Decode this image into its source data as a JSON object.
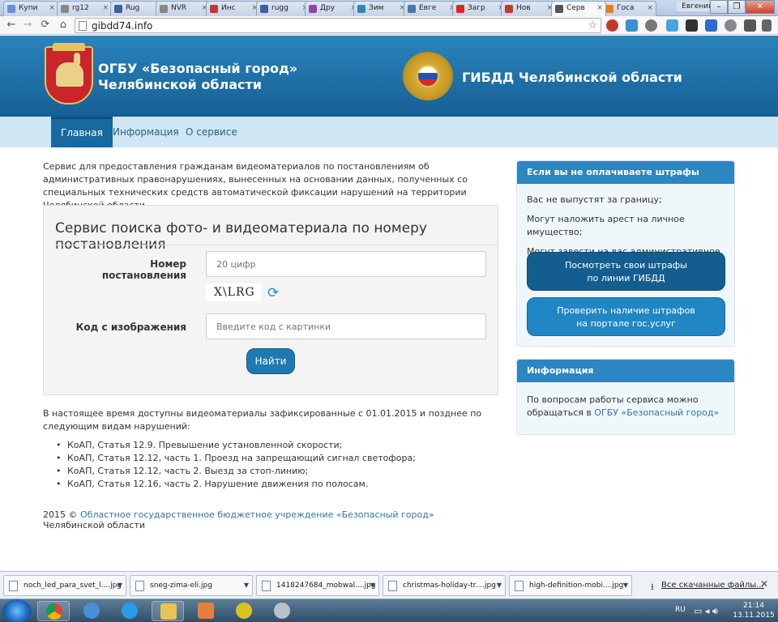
{
  "browser": {
    "tabs": [
      {
        "label": "Купи",
        "color": "#6b8fd6"
      },
      {
        "label": "rg12",
        "color": "#888888"
      },
      {
        "label": "Rug",
        "color": "#3b5fa8"
      },
      {
        "label": "NVR",
        "color": "#888888"
      },
      {
        "label": "Инс",
        "color": "#c0392b"
      },
      {
        "label": "rugg",
        "color": "#3b5fa8"
      },
      {
        "label": "Дру",
        "color": "#8e44ad"
      },
      {
        "label": "Зим",
        "color": "#2e86c1"
      },
      {
        "label": "Евге",
        "color": "#4a76a8"
      },
      {
        "label": "Загр",
        "color": "#e02424"
      },
      {
        "label": "Нов",
        "color": "#c0392b"
      },
      {
        "label": "Серв",
        "color": "#555555"
      },
      {
        "label": "Госа",
        "color": "#e67e22"
      }
    ],
    "user": "Евгений",
    "url": "gibdd74.info"
  },
  "header": {
    "org_title": "ОГБУ «Безопасный город» Челябинской области",
    "gibdd_title": "ГИБДД Челябинской области"
  },
  "nav": {
    "items": [
      "Главная",
      "Информация",
      "О сервисе"
    ]
  },
  "main": {
    "intro": "Сервис для предоставления гражданам видеоматериалов по постановлениям об административных правонарушениях, вынесенных на основании данных, полученных со специальных технических средств автоматической фиксации нарушений на территории Челябинской области.",
    "search_title": "Сервис поиска фото- и видеоматериала по номеру постановления",
    "number_label": "Номер постановления",
    "number_placeholder": "20 цифр",
    "captcha_text": "X\\LRG",
    "code_label": "Код с изображения",
    "code_placeholder": "Введите код с картинки",
    "find_button": "Найти",
    "availability": "В настоящее время доступны видеоматериалы зафиксированные с 01.01.2015 и позднее по следующим видам нарушений:",
    "violations": [
      "КоАП, Статья 12.9. Превышение установленной скорости;",
      "КоАП, Статья 12.12, часть 1. Проезд на запрещающий сигнал светофора;",
      "КоАП, Статья 12.12, часть 2. Выезд за стоп-линию;",
      "КоАП, Статья 12.16, часть 2. Нарушение движения по полосам."
    ],
    "footer_prefix": "2015 © ",
    "footer_link": "Областное государственное бюджетное учреждение «Безопасный город»",
    "footer_suffix": " Челябинской области"
  },
  "sidebar": {
    "fines_panel": {
      "title": "Если вы не оплачиваете штрафы",
      "lines": [
        "Вас не выпустят за границу;",
        "Могут наложить арест на личное имущество;",
        "Могут завести на вас административное дело."
      ],
      "button_gibdd_1": "Посмотреть свои штрафы",
      "button_gibdd_2": "по линии ГИБДД",
      "button_gosuslugi_1": "Проверить наличие штрафов",
      "button_gosuslugi_2": "на портале гос.услуг"
    },
    "info_panel": {
      "title": "Информация",
      "text_1": "По вопросам работы сервиса можно",
      "text_2": "обращаться в ",
      "link": "ОГБУ «Безопасный город»"
    }
  },
  "downloads": {
    "items": [
      "noch_led_para_svet_l....jpg",
      "sneg-zima-eli.jpg",
      "1418247684_mobwal....jpg",
      "christmas-holiday-tr....jpg",
      "high-definition-mobi....jpg"
    ],
    "all_label": "Все скачанные файлы..."
  },
  "taskbar": {
    "lang": "RU",
    "time": "21:14",
    "date": "13.11.2015"
  }
}
